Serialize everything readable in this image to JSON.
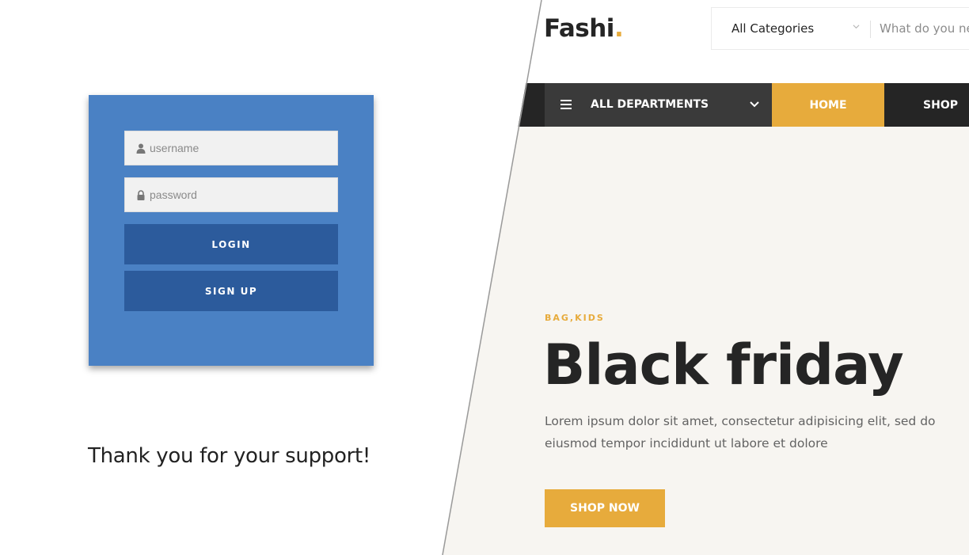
{
  "login": {
    "username_placeholder": "username",
    "password_placeholder": "password",
    "login_label": "LOGIN",
    "signup_label": "SIGN UP",
    "user_icon": "user-icon",
    "lock_icon": "lock-icon"
  },
  "thanks": "Thank you for your support!",
  "store": {
    "brand_name": "Fashi",
    "brand_dot": ".",
    "search": {
      "category_selected": "All Categories",
      "placeholder": "What do you need?"
    },
    "nav": {
      "departments_label": "ALL DEPARTMENTS",
      "items": [
        {
          "label": "HOME",
          "active": true
        },
        {
          "label": "SHOP",
          "active": false
        }
      ]
    },
    "hero": {
      "tag": "BAG,KIDS",
      "title": "Black friday",
      "description": "Lorem ipsum dolor sit amet, consectetur adipisicing elit, sed do eiusmod tempor incididunt ut labore et dolore",
      "cta_label": "SHOP NOW"
    }
  },
  "colors": {
    "accent": "#e7ab3c",
    "nav_dark": "#252525",
    "login_card": "#4a81c4",
    "login_button": "#2c5b9c",
    "hero_bg": "#f7f5f1"
  }
}
